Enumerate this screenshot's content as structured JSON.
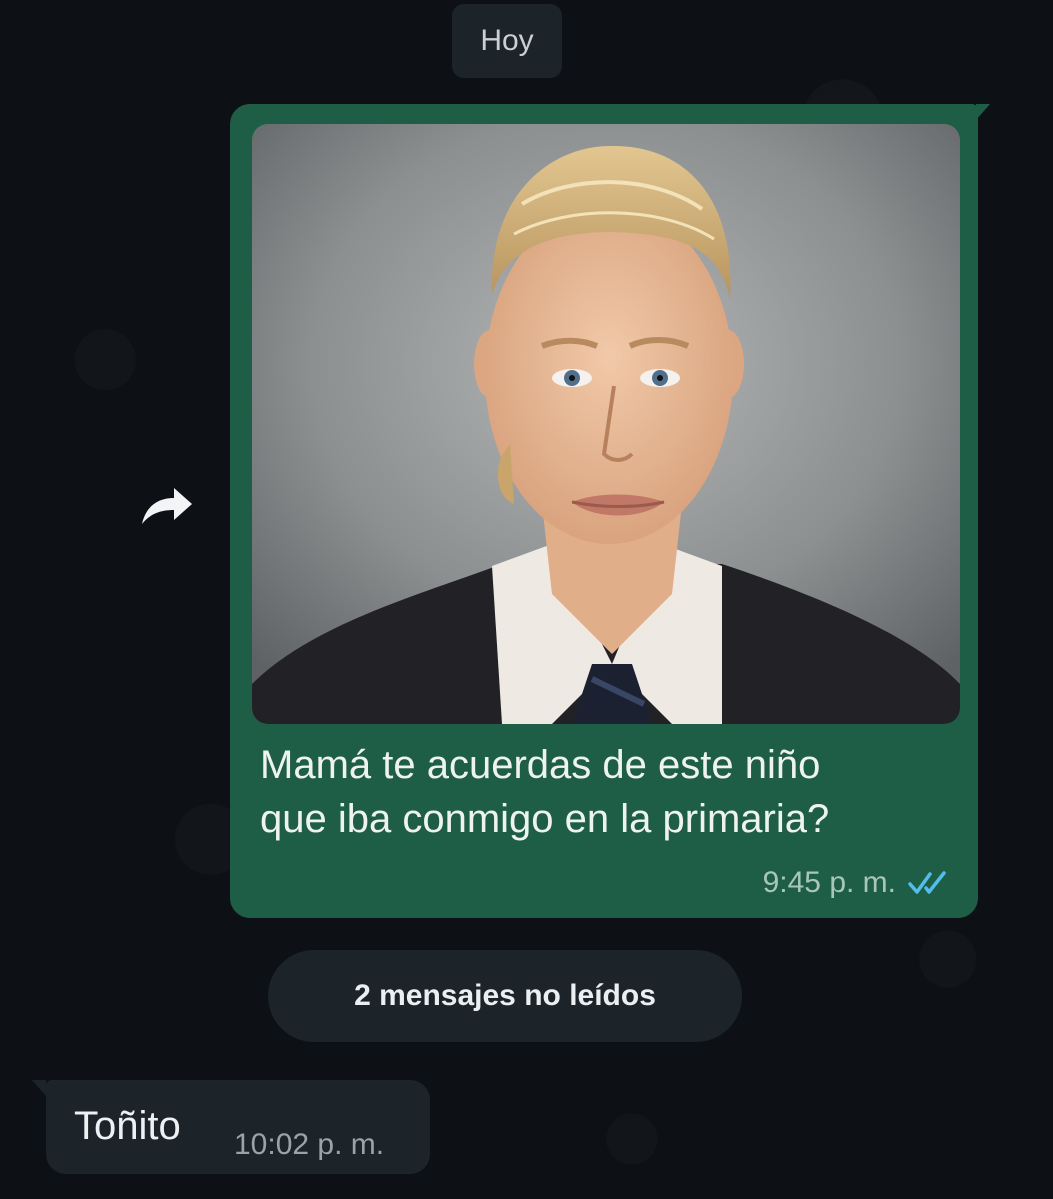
{
  "chat": {
    "date_divider": "Hoy",
    "outgoing": {
      "text_line1": "Mamá te acuerdas de este niño",
      "text_line2": "que iba conmigo en la primaria?",
      "time": "9:45 p. m.",
      "status_icon": "double-check-read-icon",
      "media": "photo-portrait"
    },
    "unread_divider": "2 mensajes no leídos",
    "incoming": {
      "text": "Toñito",
      "time": "10:02 p. m."
    },
    "colors": {
      "background": "#0d1116",
      "outgoing_bubble": "#1f5e46",
      "incoming_bubble": "#1d2429",
      "read_ticks": "#53bdeb"
    }
  }
}
